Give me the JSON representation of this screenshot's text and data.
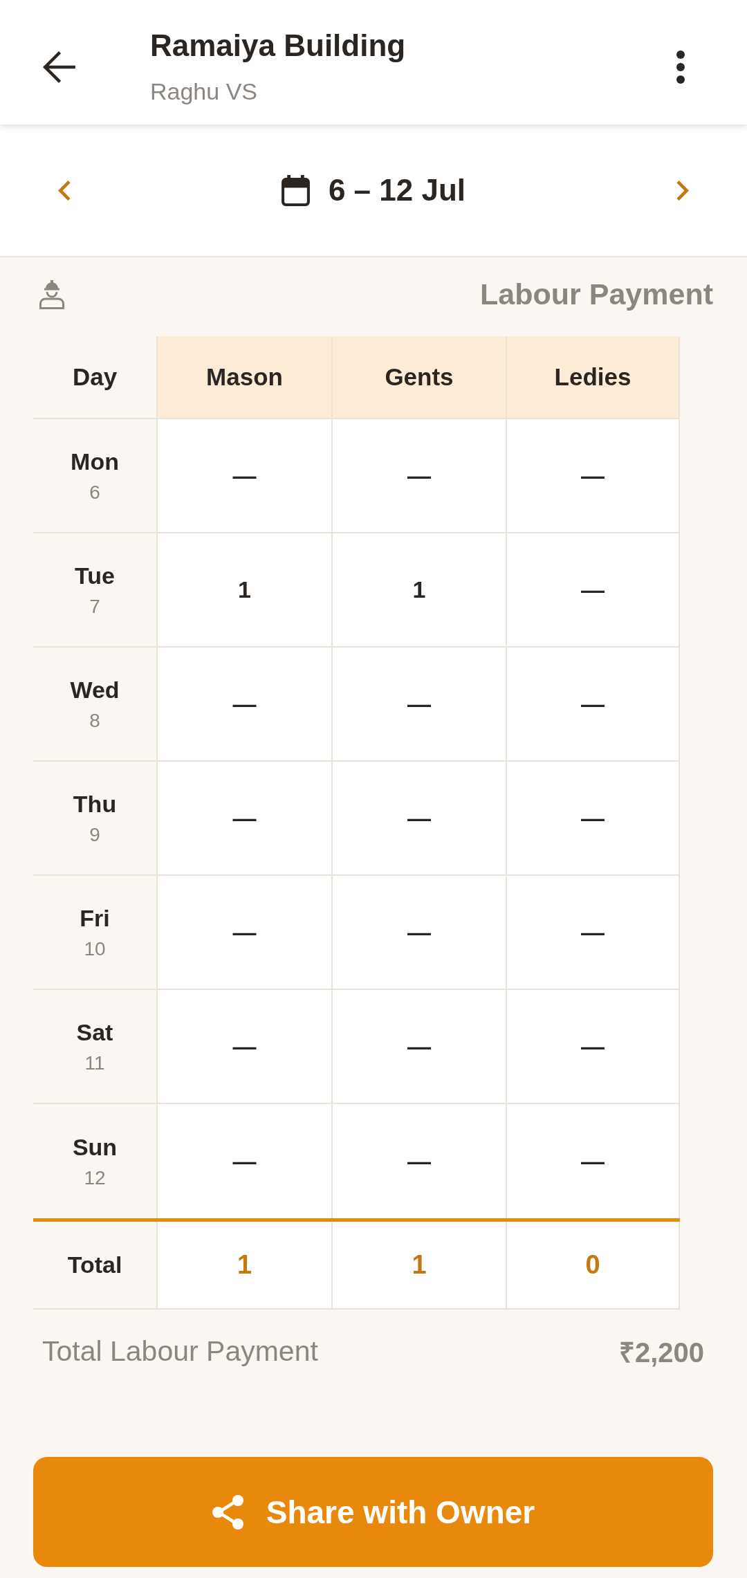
{
  "header": {
    "title": "Ramaiya Building",
    "subtitle": "Raghu VS"
  },
  "week_nav": {
    "range": "6 – 12 Jul"
  },
  "section": {
    "title": "Labour Payment"
  },
  "table": {
    "columns": [
      "Day",
      "Mason",
      "Gents",
      "Ledies"
    ],
    "rows": [
      {
        "cells": [
          {
            "day": "Mon",
            "date": "6"
          },
          "—",
          "—",
          "—"
        ]
      },
      {
        "cells": [
          {
            "day": "Tue",
            "date": "7"
          },
          "1",
          "1",
          "—"
        ]
      },
      {
        "cells": [
          {
            "day": "Wed",
            "date": "8"
          },
          "—",
          "—",
          "—"
        ]
      },
      {
        "cells": [
          {
            "day": "Thu",
            "date": "9"
          },
          "—",
          "—",
          "—"
        ]
      },
      {
        "cells": [
          {
            "day": "Fri",
            "date": "10"
          },
          "—",
          "—",
          "—"
        ]
      },
      {
        "cells": [
          {
            "day": "Sat",
            "date": "11"
          },
          "—",
          "—",
          "—"
        ]
      },
      {
        "cells": [
          {
            "day": "Sun",
            "date": "12"
          },
          "—",
          "—",
          "—"
        ]
      }
    ],
    "total": {
      "cells": [
        "Total",
        "1",
        "1",
        "0"
      ]
    }
  },
  "summary": {
    "label": "Total Labour Payment",
    "amount": "₹2,200"
  },
  "share_button": {
    "label": "Share with Owner"
  }
}
